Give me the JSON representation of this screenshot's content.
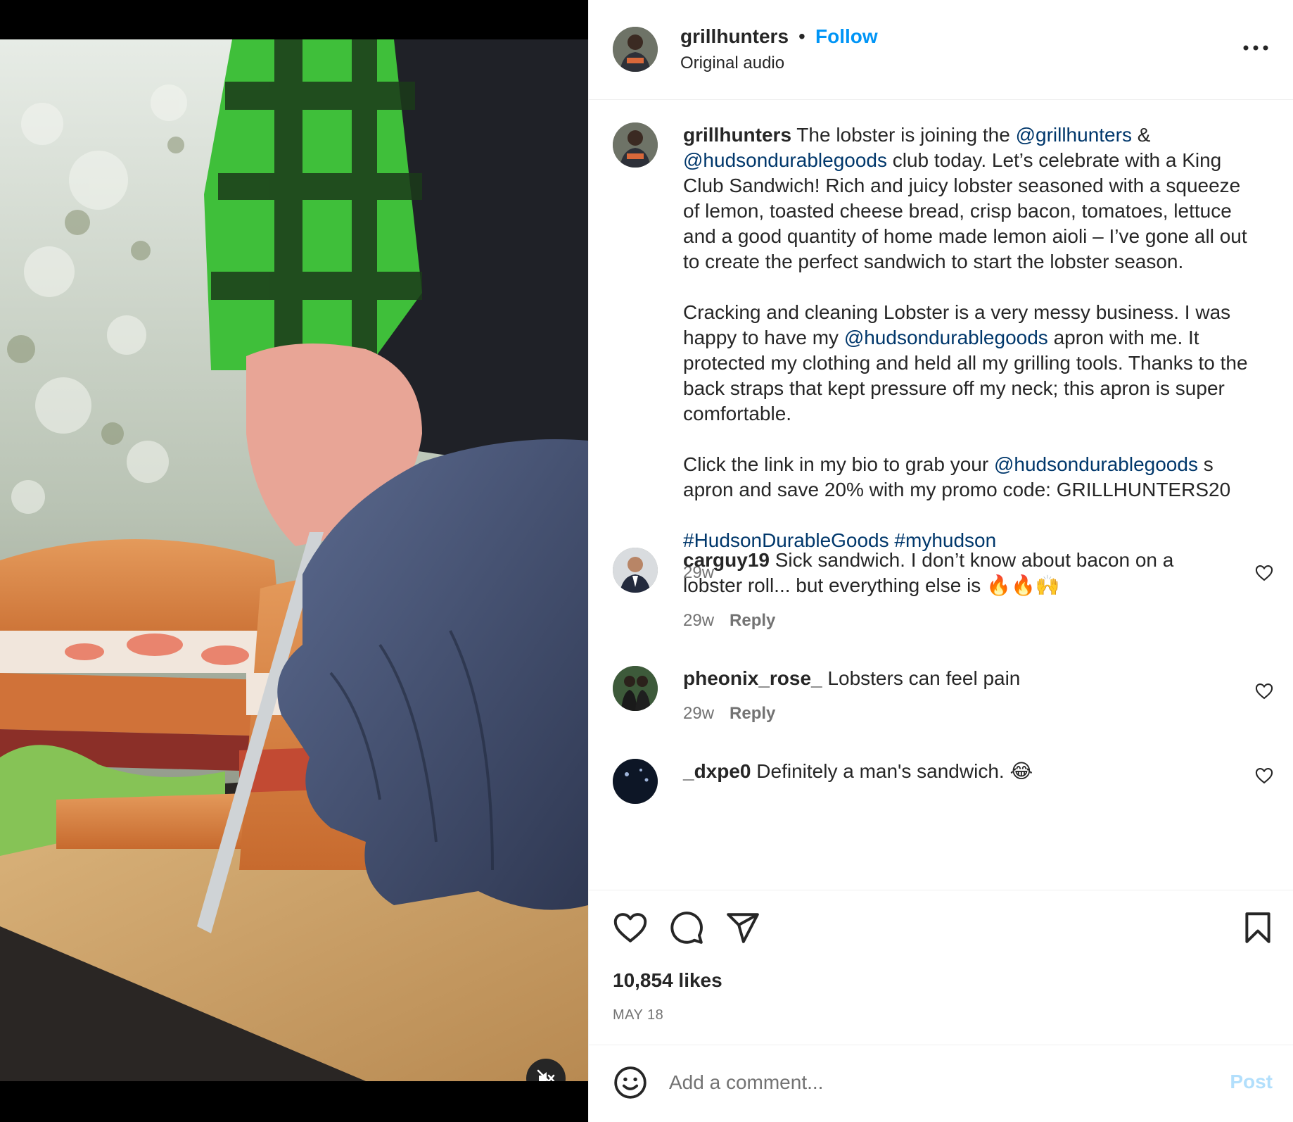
{
  "post": {
    "username": "grillhunters",
    "follow_label": "Follow",
    "separator": "•",
    "audio": "Original audio"
  },
  "caption": {
    "username": "grillhunters",
    "p1_a": " The lobster is joining the ",
    "p1_mention1": "@grillhunters",
    "p1_b": " & ",
    "p1_mention2": "@hudsondurablegoods",
    "p1_c": " club today. Let’s celebrate with a King Club Sandwich! Rich and juicy lobster seasoned with a squeeze of lemon, toasted cheese bread, crisp bacon, tomatoes, lettuce and a good quantity of home made lemon aioli – I’ve gone all out to create the perfect sandwich to start the lobster season.",
    "p2_a": "Cracking and cleaning Lobster is a very messy business. I was happy to have my ",
    "p2_mention": "@hudsondurablegoods",
    "p2_b": " apron with me. It protected my clothing and held all my grilling tools. Thanks to the back straps that kept pressure off my neck; this apron is super comfortable.",
    "p3_a": "Click the link in my bio to grab your ",
    "p3_mention": "@hudsondurablegoods",
    "p3_b": " s apron and save 20% with my promo code: GRILLHUNTERS20",
    "hashtag1": "#HudsonDurableGoods",
    "hashtag2": "#myhudson",
    "time": "29w"
  },
  "comments": [
    {
      "username": "carguy19",
      "text": " Sick sandwich. I don’t know about bacon on a lobster roll... but everything else is 🔥🔥🙌",
      "time": "29w",
      "reply": "Reply"
    },
    {
      "username": "pheonix_rose_",
      "text": " Lobsters can feel pain",
      "time": "29w",
      "reply": "Reply"
    },
    {
      "username": "_dxpe0",
      "text": " Definitely a man's sandwich. 😂"
    }
  ],
  "actions": {
    "likes": "10,854 likes",
    "date": "MAY 18"
  },
  "composer": {
    "placeholder": "Add a comment...",
    "post_label": "Post"
  },
  "colors": {
    "accent": "#0095f6",
    "mention": "#00376b",
    "muted": "#737373",
    "post_disabled": "#b2dffc"
  },
  "icons": {
    "mute": "speaker-muted-icon",
    "more": "more-horizontal-icon",
    "like": "heart-icon",
    "comment": "comment-bubble-icon",
    "share": "paper-plane-icon",
    "save": "bookmark-icon",
    "emoji": "smiley-icon"
  }
}
